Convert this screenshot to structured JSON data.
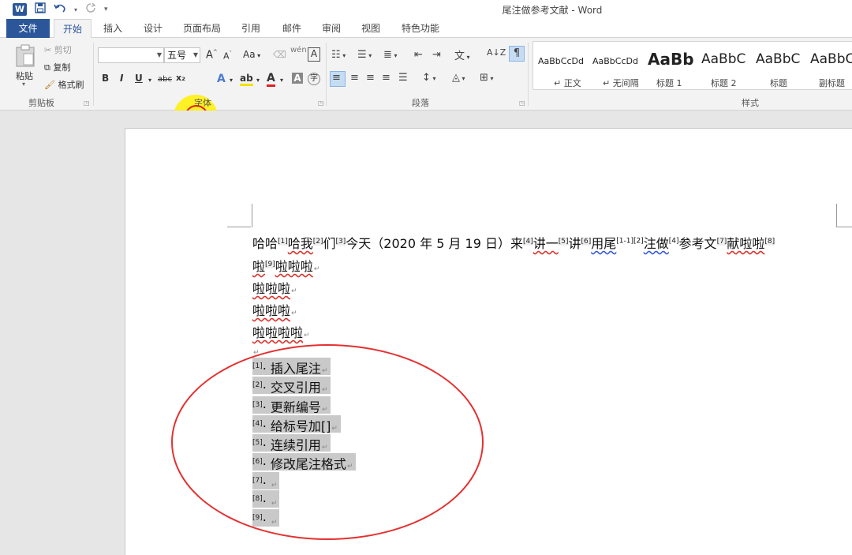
{
  "title_bar": {
    "app_icon": "word-icon",
    "title": "尾注做参考文献 - Word"
  },
  "quick_access": {
    "save": "save-icon",
    "undo": "undo-icon",
    "redo": "redo-icon",
    "customize": "▾"
  },
  "tabs": [
    "文件",
    "开始",
    "插入",
    "设计",
    "页面布局",
    "引用",
    "邮件",
    "审阅",
    "视图",
    "特色功能"
  ],
  "ribbon": {
    "clipboard": {
      "paste": "粘贴",
      "cut": "剪切",
      "copy": "复制",
      "format_painter": "格式刷",
      "label": "剪贴板"
    },
    "font": {
      "font_name": "",
      "font_size": "五号",
      "grow": "A",
      "shrink": "A",
      "case": "Aa",
      "pinyin": "wén",
      "border": "A",
      "bold": "B",
      "italic": "I",
      "underline": "U",
      "strike": "abc",
      "subscript": "x₂",
      "superscript": "x²",
      "text_effect": "A",
      "highlight": "ab",
      "font_color": "A",
      "shading": "A",
      "enclose": "字",
      "label": "字体"
    },
    "paragraph": {
      "label": "段落"
    },
    "styles": {
      "items": [
        {
          "sample": "AaBbCcDd",
          "name": "↵ 正文"
        },
        {
          "sample": "AaBbCcDd",
          "name": "↵ 无间隔"
        },
        {
          "sample": "AaBb",
          "name": "标题 1"
        },
        {
          "sample": "AaBbC",
          "name": "标题 2"
        },
        {
          "sample": "AaBbC",
          "name": "标题"
        },
        {
          "sample": "AaBbC",
          "name": "副标题"
        }
      ],
      "label": "样式"
    }
  },
  "document": {
    "line1": {
      "p1": "哈哈",
      "s1": "[1]",
      "p2": "哈我",
      "s2": "[2]",
      "p3": "们",
      "s3": "[3]",
      "p4": "今天（2020 年 5 月 19 日）来",
      "s4": "[4]",
      "p5": "讲一",
      "s5": "[5]",
      "p6": "讲",
      "s6": "[6]",
      "p7": "用尾",
      "s7": "[1-1][2]",
      "p8": "注做",
      "s8": "[4]",
      "p9": "参考文",
      "s9": "[7]",
      "p10": "献啦啦",
      "s10": "[8]"
    },
    "line2": {
      "p1": "啦",
      "s1": "[9]",
      "p2": "啦啦啦"
    },
    "line3": "啦啦啦",
    "line4": "啦啦啦",
    "line5": "啦啦啦啦",
    "endnotes": [
      {
        "num": "[1]",
        "text": "插入尾注"
      },
      {
        "num": "[2]",
        "text": "交叉引用"
      },
      {
        "num": "[3]",
        "text": "更新编号"
      },
      {
        "num": "[4]",
        "text": "给标号加[]"
      },
      {
        "num": "[5]",
        "text": "连续引用"
      },
      {
        "num": "[6]",
        "text": "修改尾注格式"
      },
      {
        "num": "[7]",
        "text": ""
      },
      {
        "num": "[8]",
        "text": ""
      },
      {
        "num": "[9]",
        "text": ""
      }
    ],
    "para_mark": "↵"
  },
  "colors": {
    "accent": "#2b579a",
    "annotation_red": "#e53030",
    "cursor_yellow": "#fff000"
  }
}
